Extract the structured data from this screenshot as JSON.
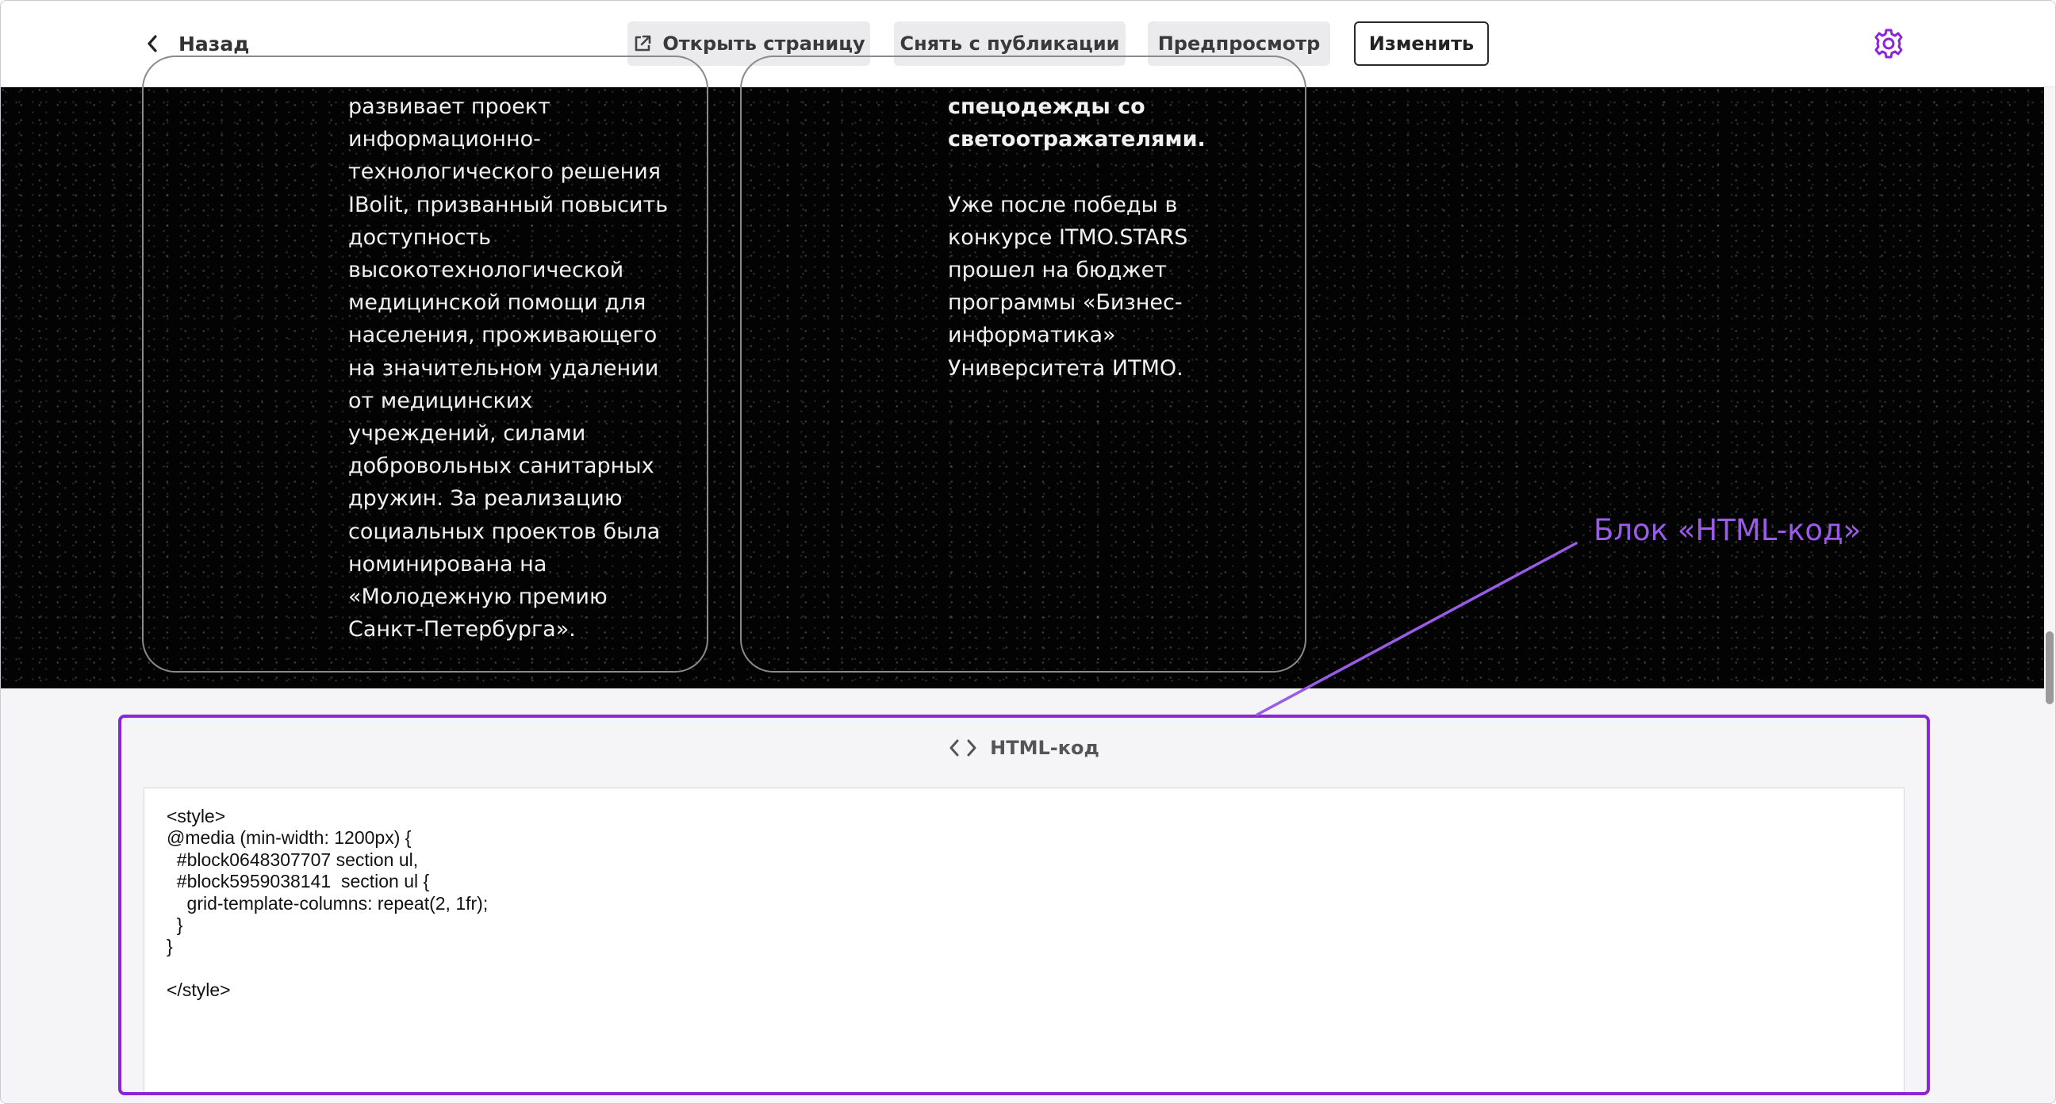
{
  "topbar": {
    "back_label": "Назад",
    "open_page": "Открыть страницу",
    "unpublish": "Снять с публикации",
    "preview": "Предпросмотр",
    "edit": "Изменить"
  },
  "preview": {
    "card_left_text": "развивает проект\nинформационно-\nтехнологического решения\nIBolit, призванный повысить\nдоступность\nвысокотехнологической\nмедицинской помощи для\nнаселения, проживающего\nна значительном удалении\nот медицинских\nучреждений, силами\nдобровольных санитарных\nдружин. За реализацию\nсоциальных проектов была\nноминирована на\n«Молодежную премию\nСанкт-Петербурга».",
    "card_right_bold": "спецодежды со\nсветоотражателями.",
    "card_right_text": "Уже после победы в\nконкурсе ITMO.STARS\nпрошел на бюджет\nпрограммы «Бизнес-\nинформатика»\nУниверситета ИТМО."
  },
  "annotation": {
    "label": "Блок «HTML-код»",
    "color": "#9a5ce6"
  },
  "html_block": {
    "title": "HTML-код",
    "code": "<style>\n@media (min-width: 1200px) {\n  #block0648307707 section ul,\n  #block5959038141  section ul {\n    grid-template-columns: repeat(2, 1fr);\n  }\n}\n\n</style>",
    "border_color": "#8a25d8"
  },
  "icons": [
    "chevron-left-icon",
    "external-link-icon",
    "gear-icon",
    "code-brackets-icon"
  ],
  "colors": {
    "accent": "#8a25d8",
    "preview_bg": "#030304"
  }
}
